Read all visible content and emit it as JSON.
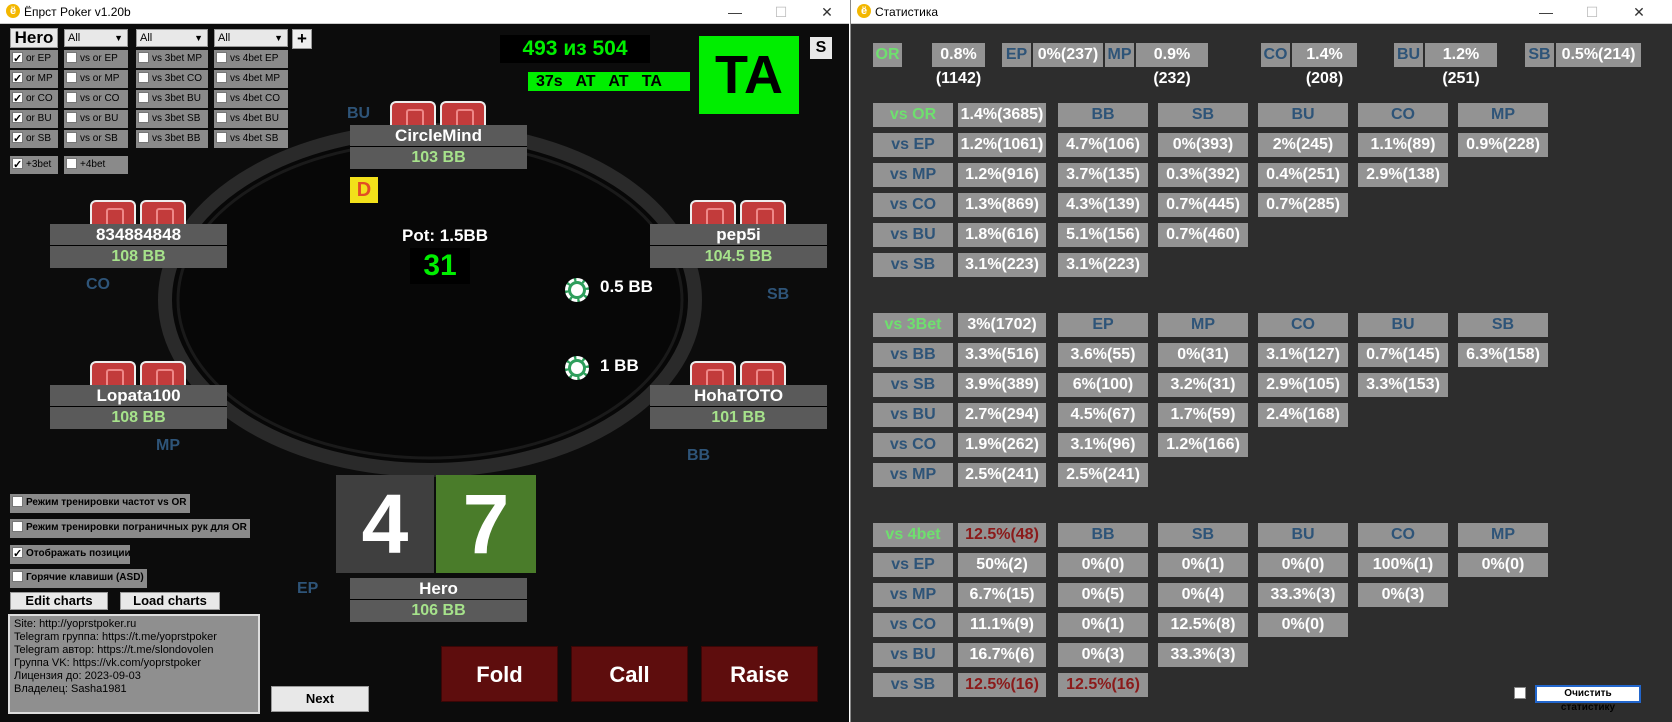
{
  "poker": {
    "title": "Ёпрст Poker v1.20b",
    "hero_btn": "Hero",
    "selects": [
      "All",
      "All",
      "All",
      "All"
    ],
    "plus": "+",
    "filters_col1": [
      {
        "label": "or EP",
        "checked": true
      },
      {
        "label": "or MP",
        "checked": true
      },
      {
        "label": "or CO",
        "checked": true
      },
      {
        "label": "or BU",
        "checked": true
      },
      {
        "label": "or SB",
        "checked": true
      },
      {
        "label": "+3bet",
        "checked": true
      }
    ],
    "filters_col2": [
      {
        "label": "vs or EP",
        "checked": false
      },
      {
        "label": "vs or MP",
        "checked": false
      },
      {
        "label": "vs or CO",
        "checked": false
      },
      {
        "label": "vs or BU",
        "checked": false
      },
      {
        "label": "vs or SB",
        "checked": false
      },
      {
        "label": "+4bet",
        "checked": false
      }
    ],
    "filters_col3": [
      {
        "label": "vs 3bet MP",
        "checked": false
      },
      {
        "label": "vs 3bet CO",
        "checked": false
      },
      {
        "label": "vs 3bet BU",
        "checked": false
      },
      {
        "label": "vs 3bet SB",
        "checked": false
      },
      {
        "label": "vs 3bet BB",
        "checked": false
      }
    ],
    "filters_col4": [
      {
        "label": "vs 4bet EP",
        "checked": false
      },
      {
        "label": "vs 4bet MP",
        "checked": false
      },
      {
        "label": "vs 4bet CO",
        "checked": false
      },
      {
        "label": "vs 4bet BU",
        "checked": false
      },
      {
        "label": "vs 4bet SB",
        "checked": false
      }
    ],
    "counter": "493 из 504",
    "timer_line": "37s   AT   AT   TA",
    "big_hand": "TA",
    "s_btn": "S",
    "pot_label": "Pot: 1.5BB",
    "pot_number": "31",
    "dealer": "D",
    "blind_sb": "0.5 BB",
    "blind_bb": "1 BB",
    "seats": {
      "top": {
        "name": "CircleMind",
        "stack": "103 BB",
        "pos": "BU"
      },
      "left_top": {
        "name": "834884848",
        "stack": "108 BB",
        "pos": "CO"
      },
      "right_top": {
        "name": "pep5i",
        "stack": "104.5 BB",
        "pos": "SB"
      },
      "left_bot": {
        "name": "Lopata100",
        "stack": "108 BB",
        "pos": "MP"
      },
      "right_bot": {
        "name": "HohaTOTO",
        "stack": "101 BB",
        "pos": "BB"
      },
      "hero": {
        "name": "Hero",
        "stack": "106 BB",
        "pos": "EP"
      }
    },
    "hero_cards": [
      "4",
      "7"
    ],
    "options": [
      {
        "label": "Режим тренировки частот vs OR",
        "checked": false
      },
      {
        "label": "Режим тренировки пограничных рук для OR",
        "checked": false
      },
      {
        "label": "Отображать позиции",
        "checked": true
      },
      {
        "label": "Горячие клавиши (ASD)",
        "checked": false
      }
    ],
    "edit_charts": "Edit charts",
    "load_charts": "Load charts",
    "info_lines": [
      "Site: http://yoprstpoker.ru",
      "Telegram группа: https://t.me/yoprstpoker",
      "Telegram автор: https://t.me/slondovolen",
      "Группа VK: https://vk.com/yoprstpoker",
      "Лицензия до: 2023-09-03",
      "Владелец: Sasha1981"
    ],
    "next": "Next",
    "fold": "Fold",
    "call": "Call",
    "raise": "Raise",
    "colors": {
      "table_bg": "#0c0c0c",
      "green": "#00ee00",
      "seat": "#5a5a5a",
      "stack": "#a6e28b",
      "card_red": "#c23b3b",
      "hero_green": "#4a7c2a",
      "action": "#5e0d0d"
    }
  },
  "stats": {
    "title": "Статистика",
    "top_row": [
      {
        "label": "OR",
        "value": "0.8%(1142)"
      },
      {
        "label": "EP",
        "value": "0%(237)"
      },
      {
        "label": "MP",
        "value": "0.9%(232)"
      },
      {
        "label": "CO",
        "value": "1.4%(208)"
      },
      {
        "label": "BU",
        "value": "1.2%(251)"
      },
      {
        "label": "SB",
        "value": "0.5%(214)"
      }
    ],
    "sections": [
      {
        "label": "vs OR",
        "total": "1.4%(3685)",
        "total_red": false,
        "headers": [
          "BB",
          "SB",
          "BU",
          "CO",
          "MP"
        ],
        "rows": [
          {
            "label": "vs EP",
            "cells": [
              "1.2%(1061)",
              "4.7%(106)",
              "0%(393)",
              "2%(245)",
              "1.1%(89)",
              "0.9%(228)"
            ]
          },
          {
            "label": "vs MP",
            "cells": [
              "1.2%(916)",
              "3.7%(135)",
              "0.3%(392)",
              "0.4%(251)",
              "2.9%(138)",
              ""
            ]
          },
          {
            "label": "vs CO",
            "cells": [
              "1.3%(869)",
              "4.3%(139)",
              "0.7%(445)",
              "0.7%(285)",
              "",
              ""
            ]
          },
          {
            "label": "vs BU",
            "cells": [
              "1.8%(616)",
              "5.1%(156)",
              "0.7%(460)",
              "",
              "",
              ""
            ]
          },
          {
            "label": "vs SB",
            "cells": [
              "3.1%(223)",
              "3.1%(223)",
              "",
              "",
              "",
              ""
            ]
          }
        ]
      },
      {
        "label": "vs 3Bet",
        "total": "3%(1702)",
        "total_red": false,
        "headers": [
          "EP",
          "MP",
          "CO",
          "BU",
          "SB"
        ],
        "rows": [
          {
            "label": "vs BB",
            "cells": [
              "3.3%(516)",
              "3.6%(55)",
              "0%(31)",
              "3.1%(127)",
              "0.7%(145)",
              "6.3%(158)"
            ]
          },
          {
            "label": "vs SB",
            "cells": [
              "3.9%(389)",
              "6%(100)",
              "3.2%(31)",
              "2.9%(105)",
              "3.3%(153)",
              ""
            ]
          },
          {
            "label": "vs BU",
            "cells": [
              "2.7%(294)",
              "4.5%(67)",
              "1.7%(59)",
              "2.4%(168)",
              "",
              ""
            ]
          },
          {
            "label": "vs CO",
            "cells": [
              "1.9%(262)",
              "3.1%(96)",
              "1.2%(166)",
              "",
              "",
              ""
            ]
          },
          {
            "label": "vs MP",
            "cells": [
              "2.5%(241)",
              "2.5%(241)",
              "",
              "",
              "",
              ""
            ]
          }
        ]
      },
      {
        "label": "vs 4bet",
        "total": "12.5%(48)",
        "total_red": true,
        "headers": [
          "BB",
          "SB",
          "BU",
          "CO",
          "MP"
        ],
        "rows": [
          {
            "label": "vs EP",
            "cells": [
              "50%(2)",
              "0%(0)",
              "0%(1)",
              "0%(0)",
              "100%(1)",
              "0%(0)"
            ]
          },
          {
            "label": "vs MP",
            "cells": [
              "6.7%(15)",
              "0%(5)",
              "0%(4)",
              "33.3%(3)",
              "0%(3)",
              ""
            ]
          },
          {
            "label": "vs CO",
            "cells": [
              "11.1%(9)",
              "0%(1)",
              "12.5%(8)",
              "0%(0)",
              "",
              ""
            ]
          },
          {
            "label": "vs BU",
            "cells": [
              "16.7%(6)",
              "0%(3)",
              "33.3%(3)",
              "",
              "",
              ""
            ]
          },
          {
            "label": "vs SB",
            "cells": [
              "12.5%(16)",
              "12.5%(16)",
              "",
              "",
              "",
              ""
            ],
            "red": true
          }
        ]
      }
    ],
    "clear_btn": "Очистить статистику"
  }
}
